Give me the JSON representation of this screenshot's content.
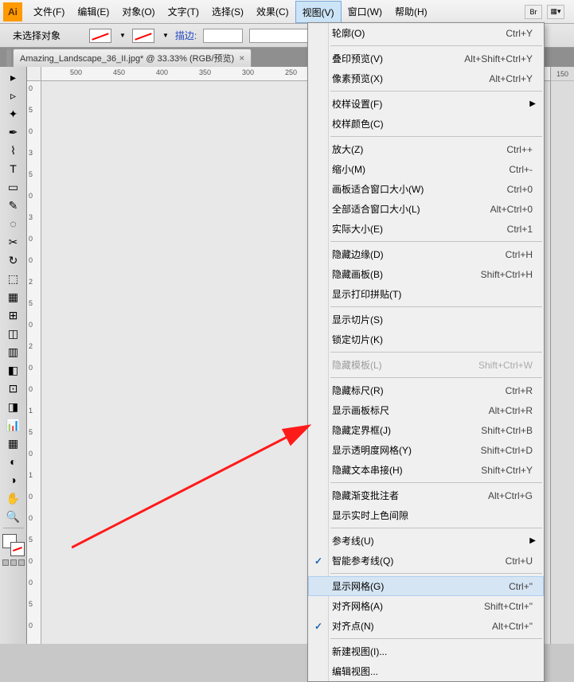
{
  "menu": {
    "items": [
      "文件(F)",
      "编辑(E)",
      "对象(O)",
      "文字(T)",
      "选择(S)",
      "效果(C)",
      "视图(V)",
      "窗口(W)",
      "帮助(H)"
    ],
    "extras": [
      "Br",
      "▦▾"
    ]
  },
  "options": {
    "no_selection": "未选择对象",
    "stroke_label": "描边:"
  },
  "tab": {
    "title": "Amazing_Landscape_36_II.jpg* @ 33.33% (RGB/预览)"
  },
  "ruler_h": [
    "500",
    "450",
    "400",
    "350",
    "300",
    "250"
  ],
  "ruler_v": [
    "0",
    "5",
    "0",
    "3",
    "5",
    "0",
    "3",
    "0",
    "0",
    "2",
    "5",
    "0",
    "2",
    "0",
    "0",
    "1",
    "5",
    "0",
    "1",
    "0",
    "0",
    "5",
    "0",
    "0",
    "5",
    "0"
  ],
  "right_ruler": "150",
  "dropdown": {
    "groups": [
      [
        {
          "label": "轮廓(O)",
          "shortcut": "Ctrl+Y"
        }
      ],
      [
        {
          "label": "叠印预览(V)",
          "shortcut": "Alt+Shift+Ctrl+Y"
        },
        {
          "label": "像素预览(X)",
          "shortcut": "Alt+Ctrl+Y"
        }
      ],
      [
        {
          "label": "校样设置(F)",
          "submenu": true
        },
        {
          "label": "校样颜色(C)"
        }
      ],
      [
        {
          "label": "放大(Z)",
          "shortcut": "Ctrl++"
        },
        {
          "label": "缩小(M)",
          "shortcut": "Ctrl+-"
        },
        {
          "label": "画板适合窗口大小(W)",
          "shortcut": "Ctrl+0"
        },
        {
          "label": "全部适合窗口大小(L)",
          "shortcut": "Alt+Ctrl+0"
        },
        {
          "label": "实际大小(E)",
          "shortcut": "Ctrl+1"
        }
      ],
      [
        {
          "label": "隐藏边缘(D)",
          "shortcut": "Ctrl+H"
        },
        {
          "label": "隐藏画板(B)",
          "shortcut": "Shift+Ctrl+H"
        },
        {
          "label": "显示打印拼贴(T)"
        }
      ],
      [
        {
          "label": "显示切片(S)"
        },
        {
          "label": "锁定切片(K)"
        }
      ],
      [
        {
          "label": "隐藏模板(L)",
          "shortcut": "Shift+Ctrl+W",
          "disabled": true
        }
      ],
      [
        {
          "label": "隐藏标尺(R)",
          "shortcut": "Ctrl+R"
        },
        {
          "label": "显示画板标尺",
          "shortcut": "Alt+Ctrl+R"
        },
        {
          "label": "隐藏定界框(J)",
          "shortcut": "Shift+Ctrl+B"
        },
        {
          "label": "显示透明度网格(Y)",
          "shortcut": "Shift+Ctrl+D"
        },
        {
          "label": "隐藏文本串接(H)",
          "shortcut": "Shift+Ctrl+Y"
        }
      ],
      [
        {
          "label": "隐藏渐变批注者",
          "shortcut": "Alt+Ctrl+G"
        },
        {
          "label": "显示实时上色间隙"
        }
      ],
      [
        {
          "label": "参考线(U)",
          "submenu": true
        },
        {
          "label": "智能参考线(Q)",
          "shortcut": "Ctrl+U",
          "checked": true
        }
      ],
      [
        {
          "label": "显示网格(G)",
          "shortcut": "Ctrl+\"",
          "highlight": true
        },
        {
          "label": "对齐网格(A)",
          "shortcut": "Shift+Ctrl+\""
        },
        {
          "label": "对齐点(N)",
          "shortcut": "Alt+Ctrl+\"",
          "checked": true
        }
      ],
      [
        {
          "label": "新建视图(I)..."
        },
        {
          "label": "编辑视图..."
        }
      ]
    ]
  },
  "tool_icons": [
    "▸",
    "▹",
    "✦",
    "✒",
    "⌇",
    "T",
    "▭",
    "✎",
    "◌",
    "✂",
    "↻",
    "⬚",
    "▦",
    "⊞",
    "◫",
    "▥",
    "◧",
    "⊡",
    "◨",
    "📊",
    "▦",
    "◐",
    "◑",
    "✋",
    "🔍"
  ]
}
